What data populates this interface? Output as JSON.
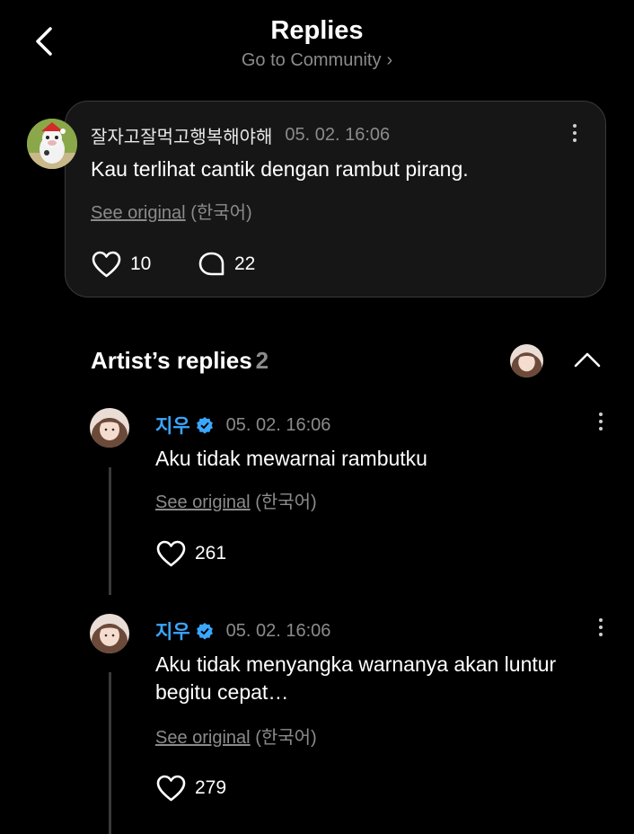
{
  "header": {
    "title": "Replies",
    "subtitle": "Go to Community",
    "subtitle_chevron": "›"
  },
  "comment": {
    "author": "잘자고잘먹고행복해야해",
    "timestamp": "05. 02. 16:06",
    "text": "Kau terlihat cantik dengan rambut pirang.",
    "see_original": "See original",
    "language": "(한국어)",
    "likes": "10",
    "replies": "22"
  },
  "artist_replies": {
    "title": "Artist’s replies",
    "count": "2",
    "items": [
      {
        "name": "지우",
        "timestamp": "05. 02. 16:06",
        "text": "Aku tidak mewarnai rambutku",
        "see_original": "See original",
        "language": "(한국어)",
        "likes": "261"
      },
      {
        "name": "지우",
        "timestamp": "05. 02. 16:06",
        "text": "Aku tidak menyangka warnanya akan luntur begitu cepat…",
        "see_original": "See original",
        "language": "(한국어)",
        "likes": "279"
      }
    ]
  },
  "colors": {
    "background": "#000000",
    "card": "#161616",
    "artist_name": "#3aa7ff",
    "verified_badge": "#3aa7ff",
    "muted_text": "#8b8b8b"
  },
  "icons": [
    "back-arrow-icon",
    "chevron-right-icon",
    "more-vertical-icon",
    "heart-icon",
    "comment-bubble-icon",
    "chevron-up-icon",
    "verified-badge-icon"
  ]
}
